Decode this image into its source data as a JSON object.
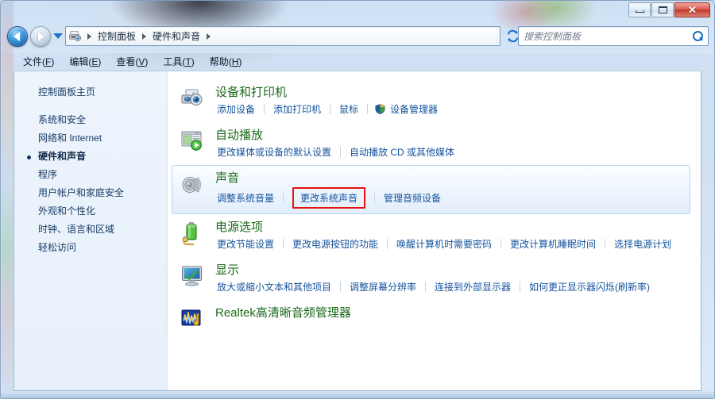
{
  "window": {
    "controls": {
      "minimize_label": "–",
      "maximize_label": "□",
      "close_label": "✕"
    }
  },
  "nav": {
    "back_label": "←",
    "forward_label": "→",
    "history_label": "▼",
    "refresh_label": "↻",
    "breadcrumbs": [
      {
        "label": "控制面板"
      },
      {
        "label": "硬件和声音"
      }
    ],
    "dropdown_label": "▼"
  },
  "search": {
    "placeholder": "搜索控制面板",
    "value": "",
    "icon": "search-icon"
  },
  "menubar": {
    "items": [
      {
        "text": "文件",
        "accel": "F"
      },
      {
        "text": "编辑",
        "accel": "E"
      },
      {
        "text": "查看",
        "accel": "V"
      },
      {
        "text": "工具",
        "accel": "T"
      },
      {
        "text": "帮助",
        "accel": "H"
      }
    ]
  },
  "sidebar": {
    "home_label": "控制面板主页",
    "items": [
      {
        "label": "系统和安全",
        "current": false
      },
      {
        "label": "网络和 Internet",
        "current": false
      },
      {
        "label": "硬件和声音",
        "current": true
      },
      {
        "label": "程序",
        "current": false
      },
      {
        "label": "用户帐户和家庭安全",
        "current": false
      },
      {
        "label": "外观和个性化",
        "current": false
      },
      {
        "label": "时钟、语言和区域",
        "current": false
      },
      {
        "label": "轻松访问",
        "current": false
      }
    ]
  },
  "categories": [
    {
      "id": "devices-and-printers",
      "icon": "printer-camera-icon",
      "title": "设备和打印机",
      "title_color": "green",
      "hovered": false,
      "links": [
        {
          "label": "添加设备",
          "shield": false,
          "highlighted": false
        },
        {
          "label": "添加打印机",
          "shield": false,
          "highlighted": false
        },
        {
          "label": "鼠标",
          "shield": false,
          "highlighted": false
        },
        {
          "label": "设备管理器",
          "shield": true,
          "highlighted": false
        }
      ]
    },
    {
      "id": "autoplay",
      "icon": "autoplay-icon",
      "title": "自动播放",
      "title_color": "green",
      "hovered": false,
      "links": [
        {
          "label": "更改媒体或设备的默认设置",
          "shield": false,
          "highlighted": false
        },
        {
          "label": "自动播放 CD 或其他媒体",
          "shield": false,
          "highlighted": false
        }
      ]
    },
    {
      "id": "sound",
      "icon": "speaker-icon",
      "title": "声音",
      "title_color": "green",
      "hovered": true,
      "links": [
        {
          "label": "调整系统音量",
          "shield": false,
          "highlighted": false
        },
        {
          "label": "更改系统声音",
          "shield": false,
          "highlighted": true
        },
        {
          "label": "管理音频设备",
          "shield": false,
          "highlighted": false
        }
      ]
    },
    {
      "id": "power-options",
      "icon": "battery-icon",
      "title": "电源选项",
      "title_color": "green",
      "hovered": false,
      "links": [
        {
          "label": "更改节能设置",
          "shield": false,
          "highlighted": false
        },
        {
          "label": "更改电源按钮的功能",
          "shield": false,
          "highlighted": false
        },
        {
          "label": "唤醒计算机时需要密码",
          "shield": false,
          "highlighted": false
        },
        {
          "label": "更改计算机睡眠时间",
          "shield": false,
          "highlighted": false
        },
        {
          "label": "选择电源计划",
          "shield": false,
          "highlighted": false
        }
      ]
    },
    {
      "id": "display",
      "icon": "monitor-icon",
      "title": "显示",
      "title_color": "green",
      "hovered": false,
      "links": [
        {
          "label": "放大或缩小文本和其他项目",
          "shield": false,
          "highlighted": false
        },
        {
          "label": "调整屏幕分辨率",
          "shield": false,
          "highlighted": false
        },
        {
          "label": "连接到外部显示器",
          "shield": false,
          "highlighted": false
        },
        {
          "label": "如何更正显示器闪烁(刷新率)",
          "shield": false,
          "highlighted": false
        }
      ]
    },
    {
      "id": "realtek-hd-audio-manager",
      "icon": "realtek-audio-icon",
      "title": "Realtek高清晰音频管理器",
      "title_color": "green",
      "hovered": false,
      "links": []
    }
  ],
  "colors": {
    "category_title_green": "#1a6a1a",
    "link_blue": "#15539e",
    "highlight_red": "#e8140c",
    "sidebar_bg": "#eaf2fb",
    "hover_bg": "#e9f2fc"
  }
}
